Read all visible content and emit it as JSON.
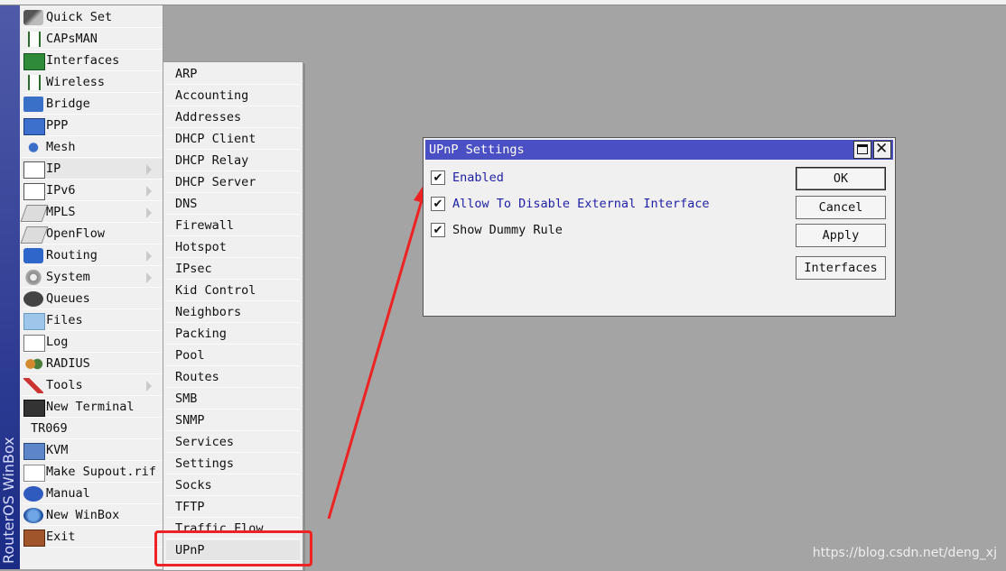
{
  "brand": "RouterOS WinBox",
  "main_menu": [
    {
      "label": "Quick Set",
      "icon": "quick-set-icon",
      "arrow": false
    },
    {
      "label": "CAPsMAN",
      "icon": "antenna-icon",
      "arrow": false
    },
    {
      "label": "Interfaces",
      "icon": "interfaces-icon",
      "arrow": false
    },
    {
      "label": "Wireless",
      "icon": "antenna-icon",
      "arrow": false
    },
    {
      "label": "Bridge",
      "icon": "bridge-icon",
      "arrow": false
    },
    {
      "label": "PPP",
      "icon": "ppp-icon",
      "arrow": false
    },
    {
      "label": "Mesh",
      "icon": "mesh-icon",
      "arrow": false
    },
    {
      "label": "IP",
      "icon": "ip-icon",
      "arrow": true
    },
    {
      "label": "IPv6",
      "icon": "ipv6-icon",
      "arrow": true
    },
    {
      "label": "MPLS",
      "icon": "mpls-icon",
      "arrow": true
    },
    {
      "label": "OpenFlow",
      "icon": "openflow-icon",
      "arrow": false
    },
    {
      "label": "Routing",
      "icon": "routing-icon",
      "arrow": true
    },
    {
      "label": "System",
      "icon": "gear-icon",
      "arrow": true
    },
    {
      "label": "Queues",
      "icon": "queues-icon",
      "arrow": false
    },
    {
      "label": "Files",
      "icon": "folder-icon",
      "arrow": false
    },
    {
      "label": "Log",
      "icon": "log-icon",
      "arrow": false
    },
    {
      "label": "RADIUS",
      "icon": "users-icon",
      "arrow": false
    },
    {
      "label": "Tools",
      "icon": "tools-icon",
      "arrow": true
    },
    {
      "label": "New Terminal",
      "icon": "terminal-icon",
      "arrow": false
    },
    {
      "label": "TR069",
      "icon": "",
      "arrow": false
    },
    {
      "label": "KVM",
      "icon": "monitor-icon",
      "arrow": false
    },
    {
      "label": "Make Supout.rif",
      "icon": "document-icon",
      "arrow": false
    },
    {
      "label": "Manual",
      "icon": "help-icon",
      "arrow": false
    },
    {
      "label": "New WinBox",
      "icon": "globe-icon",
      "arrow": false
    },
    {
      "label": "Exit",
      "icon": "exit-door-icon",
      "arrow": false
    }
  ],
  "ip_submenu": [
    "ARP",
    "Accounting",
    "Addresses",
    "DHCP Client",
    "DHCP Relay",
    "DHCP Server",
    "DNS",
    "Firewall",
    "Hotspot",
    "IPsec",
    "Kid Control",
    "Neighbors",
    "Packing",
    "Pool",
    "Routes",
    "SMB",
    "SNMP",
    "Services",
    "Settings",
    "Socks",
    "TFTP",
    "Traffic Flow",
    "UPnP"
  ],
  "dialog": {
    "title": "UPnP Settings",
    "checkboxes": [
      {
        "label": "Enabled",
        "checked": true,
        "color": "#1f1fa6"
      },
      {
        "label": "Allow To Disable External Interface",
        "checked": true,
        "color": "#1f1fa6"
      },
      {
        "label": "Show Dummy Rule",
        "checked": true,
        "color": "#111111"
      }
    ],
    "buttons": {
      "ok": "OK",
      "cancel": "Cancel",
      "apply": "Apply",
      "interfaces": "Interfaces"
    }
  },
  "watermark": "https://blog.csdn.net/deng_xj",
  "colors": {
    "highlight_red": "#e22222",
    "title_blue": "#4a4fc3"
  }
}
